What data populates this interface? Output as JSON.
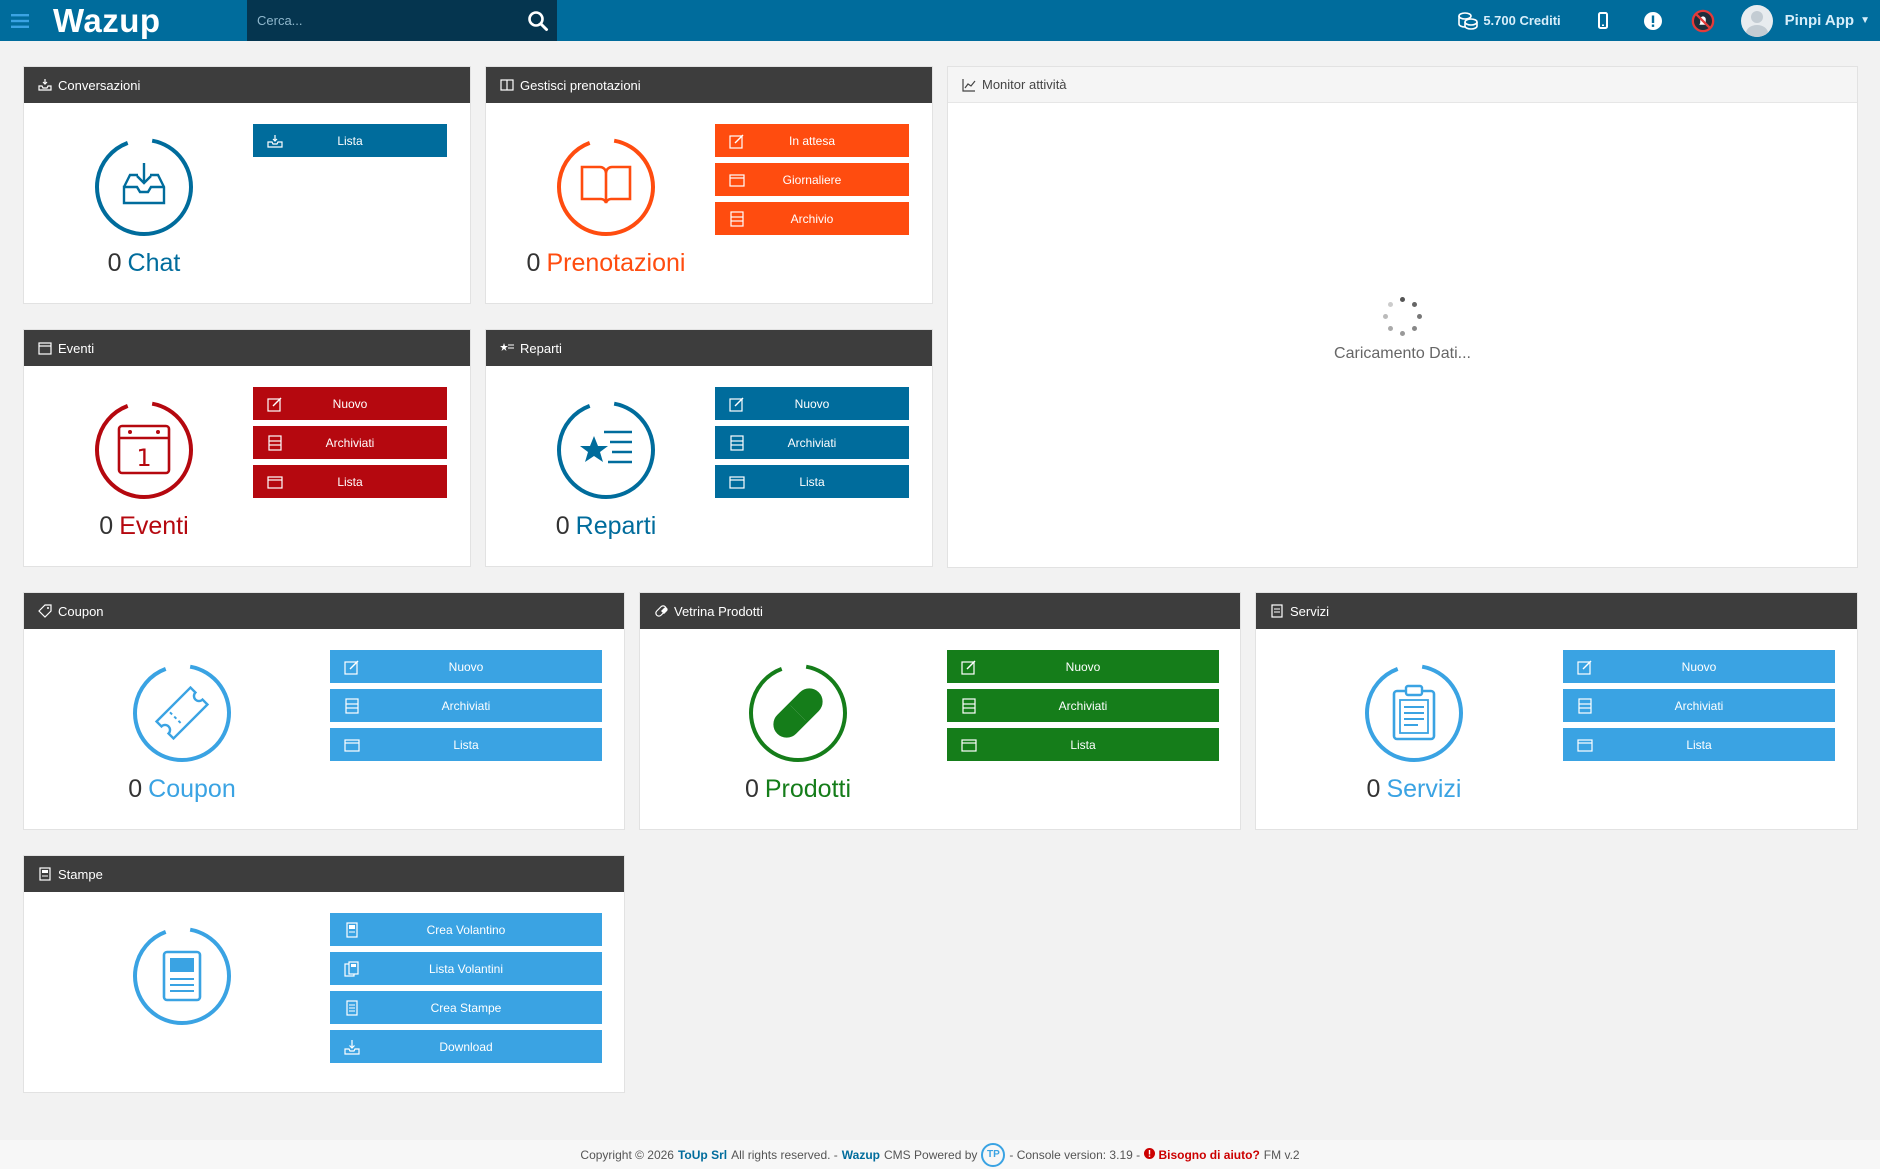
{
  "topbar": {
    "brand": "Wazup",
    "search_placeholder": "Cerca...",
    "credits": "5.700 Crediti",
    "user_name": "Pinpi App"
  },
  "conversazioni": {
    "title": "Conversazioni",
    "count": "0",
    "label": "Chat",
    "buttons": [
      "Lista"
    ]
  },
  "prenotazioni": {
    "title": "Gestisci prenotazioni",
    "count": "0",
    "label": "Prenotazioni",
    "buttons": [
      "In attesa",
      "Giornaliere",
      "Archivio"
    ]
  },
  "monitor": {
    "title": "Monitor attività",
    "loading": "Caricamento Dati..."
  },
  "eventi": {
    "title": "Eventi",
    "count": "0",
    "label": "Eventi",
    "buttons": [
      "Nuovo",
      "Archiviati",
      "Lista"
    ]
  },
  "reparti": {
    "title": "Reparti",
    "count": "0",
    "label": "Reparti",
    "buttons": [
      "Nuovo",
      "Archiviati",
      "Lista"
    ]
  },
  "coupon": {
    "title": "Coupon",
    "count": "0",
    "label": "Coupon",
    "buttons": [
      "Nuovo",
      "Archiviati",
      "Lista"
    ]
  },
  "prodotti": {
    "title": "Vetrina Prodotti",
    "count": "0",
    "label": "Prodotti",
    "buttons": [
      "Nuovo",
      "Archiviati",
      "Lista"
    ]
  },
  "servizi": {
    "title": "Servizi",
    "count": "0",
    "label": "Servizi",
    "buttons": [
      "Nuovo",
      "Archiviati",
      "Lista"
    ]
  },
  "stampe": {
    "title": "Stampe",
    "buttons": [
      "Crea Volantino",
      "Lista Volantini",
      "Crea Stampe",
      "Download"
    ]
  },
  "footer": {
    "copyright": "Copyright © 2026",
    "company": "ToUp Srl",
    "rights": "All rights reserved. -",
    "brand": "Wazup",
    "cms": "CMS Powered by",
    "version": "- Console version: 3.19 -",
    "help": "Bisogno di aiuto?",
    "fm": "FM v.2"
  },
  "colors": {
    "topbar": "#006c9c",
    "search_bg": "#05354f",
    "panel_header": "#3d3d3d",
    "blue": "#006c9c",
    "orange": "#ff4c0f",
    "red": "#b5080f",
    "light_blue": "#3aa3e3",
    "green": "#157d1a"
  }
}
